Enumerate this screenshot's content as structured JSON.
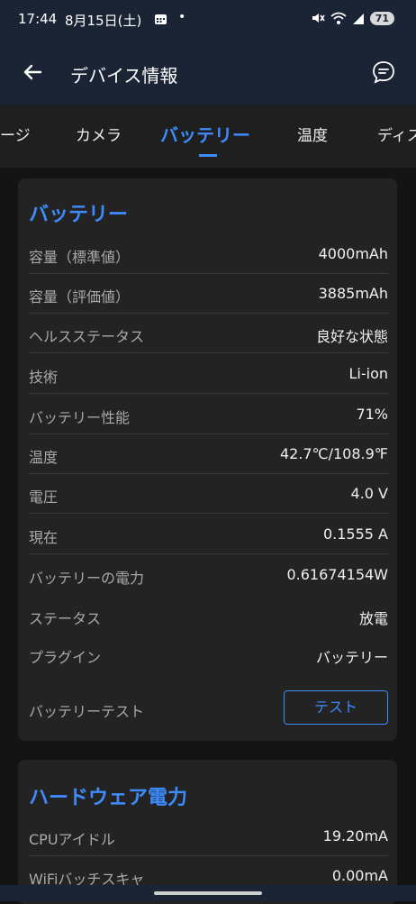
{
  "status_bar": {
    "time": "17:44",
    "date": "8月15日(土)",
    "dot": "•",
    "battery_level": "71"
  },
  "app_bar": {
    "title": "デバイス情報"
  },
  "tabs": [
    {
      "label": "ージ"
    },
    {
      "label": "カメラ"
    },
    {
      "label": "バッテリー"
    },
    {
      "label": "温度"
    },
    {
      "label": "ディス"
    }
  ],
  "battery_card": {
    "title": "バッテリー",
    "rows": [
      {
        "label": "容量（標準値）",
        "value": "4000mAh"
      },
      {
        "label": "容量（評価値）",
        "value": "3885mAh"
      },
      {
        "label": "ヘルスステータス",
        "value": "良好な状態"
      },
      {
        "label": "技術",
        "value": "Li-ion"
      },
      {
        "label": "バッテリー性能",
        "value": "71%"
      },
      {
        "label": "温度",
        "value": "42.7℃/108.9℉"
      },
      {
        "label": "電圧",
        "value": "4.0 V"
      },
      {
        "label": "現在",
        "value": "0.1555 A"
      },
      {
        "label": "バッテリーの電力",
        "value": "0.61674154W"
      },
      {
        "label": "ステータス",
        "value": "放電"
      },
      {
        "label": "プラグイン",
        "value": "バッテリー"
      }
    ],
    "test_label": "バッテリーテスト",
    "test_button": "テスト"
  },
  "hardware_card": {
    "title": "ハードウェア電力",
    "rows": [
      {
        "label": "CPUアイドル",
        "value": "19.20mA"
      },
      {
        "label": "WiFiバッチスキャ",
        "value": "0.00mA"
      }
    ]
  },
  "colors": {
    "accent": "#3d8bfd",
    "header_bg": "#1b2434",
    "card_bg": "#232323"
  }
}
